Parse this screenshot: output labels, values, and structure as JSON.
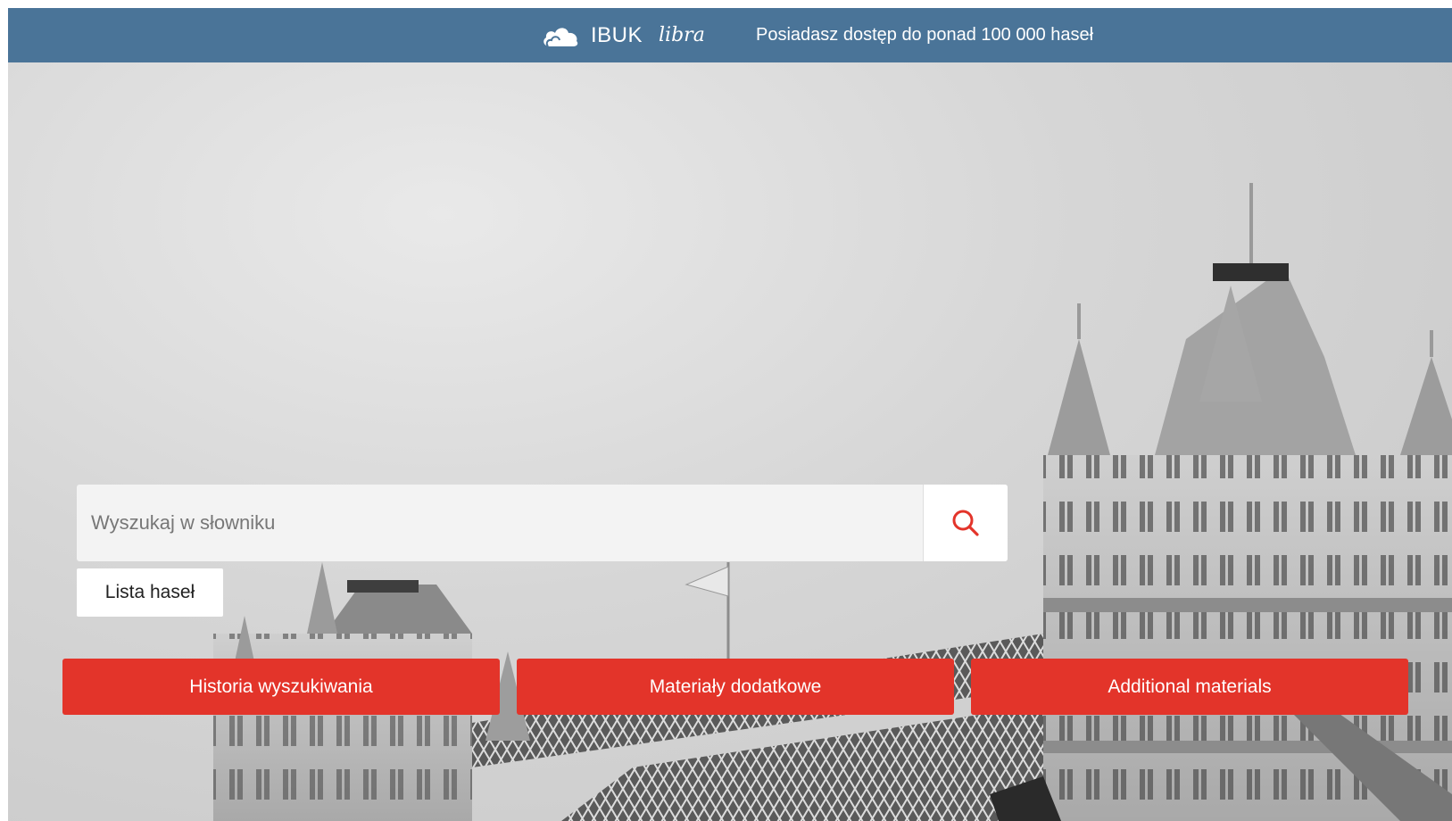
{
  "header": {
    "brand_name": "IBUK",
    "brand_sub": "libra",
    "tagline": "Posiadasz dostęp do ponad 100 000 haseł",
    "color": "#4a7498"
  },
  "search": {
    "placeholder": "Wyszukaj w słowniku",
    "icon": "search-icon",
    "accent": "#e3342a"
  },
  "links": {
    "entry_list": "Lista haseł"
  },
  "actions": [
    {
      "label": "Historia wyszukiwania"
    },
    {
      "label": "Materiały dodatkowe"
    },
    {
      "label": "Additional materials"
    }
  ],
  "hero": {
    "image": "tower-bridge-grayscale"
  }
}
